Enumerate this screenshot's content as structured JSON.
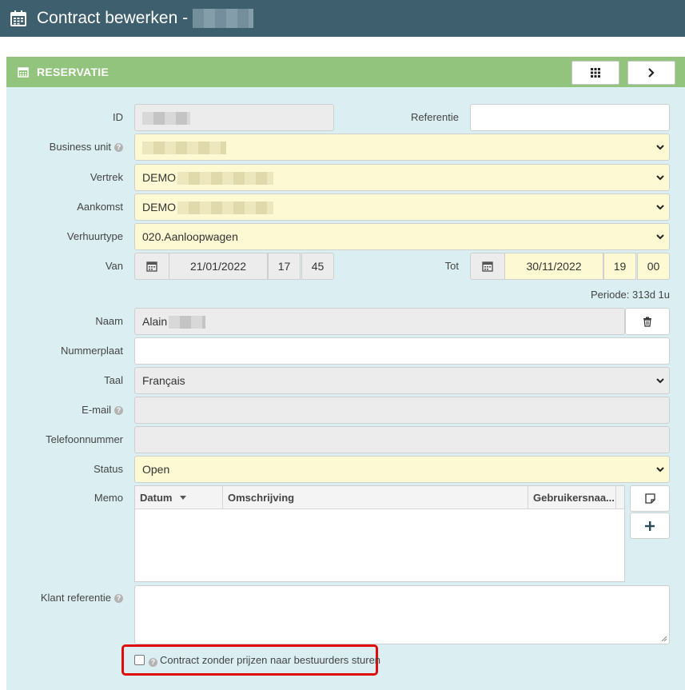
{
  "header": {
    "title": "Contract bewerken -"
  },
  "panel": {
    "title": "RESERVATIE"
  },
  "form": {
    "id_label": "ID",
    "referentie_label": "Referentie",
    "referentie_value": "",
    "business_unit_label": "Business unit",
    "vertrek_label": "Vertrek",
    "vertrek_value": "DEMO",
    "aankomst_label": "Aankomst",
    "aankomst_value": "DEMO",
    "verhuurtype_label": "Verhuurtype",
    "verhuurtype_value": "020.Aanloopwagen",
    "van_label": "Van",
    "van_date": "21/01/2022",
    "van_hour": "17",
    "van_min": "45",
    "tot_label": "Tot",
    "tot_date": "30/11/2022",
    "tot_hour": "19",
    "tot_min": "00",
    "periode": "Periode: 313d 1u",
    "naam_label": "Naam",
    "naam_value": "Alain",
    "nummerplaat_label": "Nummerplaat",
    "nummerplaat_value": "",
    "taal_label": "Taal",
    "taal_value": "Français",
    "email_label": "E-mail",
    "telefoon_label": "Telefoonnummer",
    "status_label": "Status",
    "status_value": "Open",
    "memo_label": "Memo",
    "klant_ref_label": "Klant referentie",
    "checkbox_label": "Contract zonder prijzen naar bestuurders sturen"
  },
  "memo": {
    "columns": [
      "Datum",
      "Omschrijving",
      "Gebruikersnaa..."
    ]
  },
  "icons": {
    "title": "calendar-icon",
    "panel": "calendar-icon",
    "grid": "grid-icon",
    "next": "chevron-right-icon",
    "trash": "trash-icon",
    "note": "note-icon",
    "add": "plus-icon",
    "help": "help-icon"
  },
  "colors": {
    "titlebar": "#3d5f6e",
    "panel_header": "#93c47d",
    "panel_body": "#dbeff3",
    "required_field": "#fdf9d2",
    "readonly_field": "#ececec",
    "highlight": "#e00b0b"
  }
}
